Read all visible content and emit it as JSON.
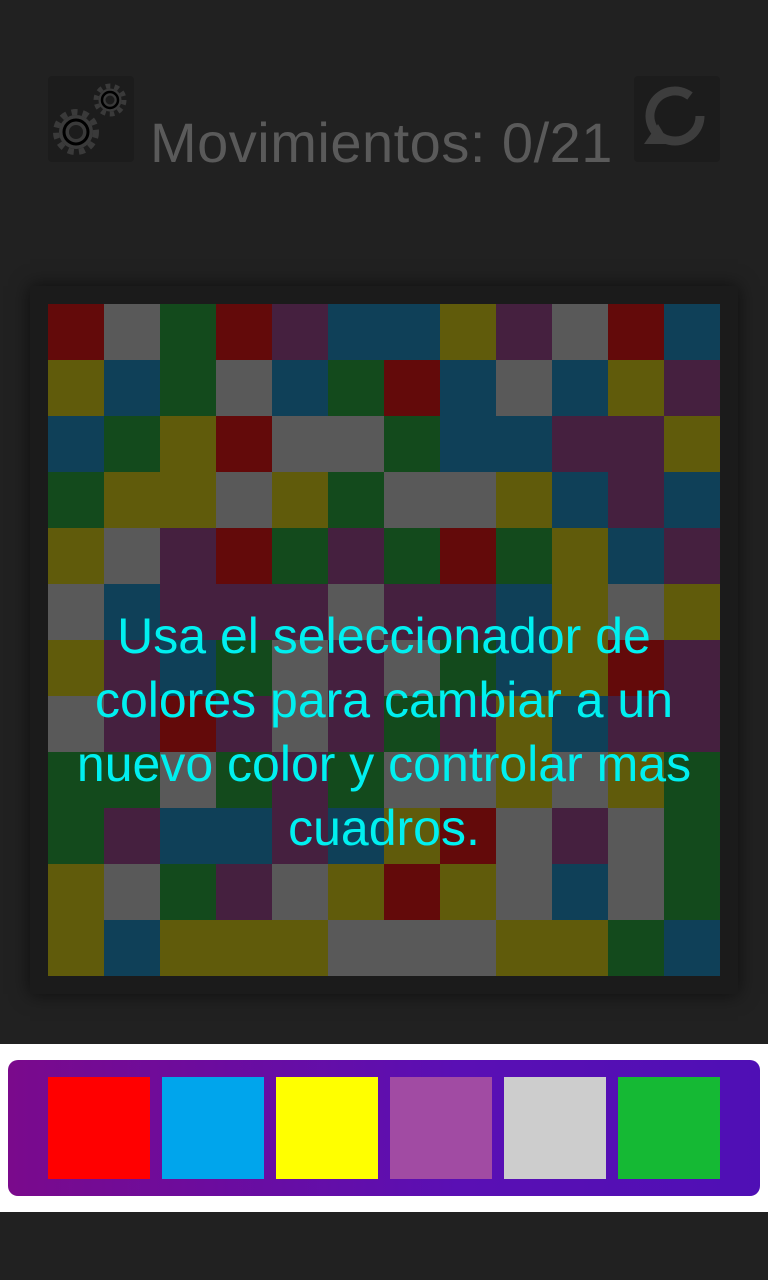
{
  "header": {
    "moves_label": "Movimientos: 0/21",
    "settings_icon": "gears-icon",
    "reset_icon": "refresh-icon"
  },
  "colors": {
    "R": "#630a0a",
    "G": "#595959",
    "N": "#134a1c",
    "B": "#0f4058",
    "P": "#45203f",
    "Y": "#605b0b"
  },
  "board": {
    "size": 12,
    "rows": [
      "RGNRPBBYPGRB",
      "YBNGBNRBGBYP",
      "BNYRGGNBBPPY",
      "NYYGYNGGYBPB",
      "YGPRNPNRNYBP",
      "GBPPPGPPBYGY",
      "YPBNGPGNBYRP",
      "GPRPGPNPYBPP",
      "NNGNPNGGYGYN",
      "NPBBPBYRGPGN",
      "YGNPGYRYGBGN",
      "YBYYYGGGYYNB"
    ]
  },
  "tip": {
    "text": "Usa el seleccionador de colores para cambiar a un nuevo color y controlar mas cuadros."
  },
  "palette": {
    "swatches": [
      {
        "name": "red",
        "color": "#ff0000"
      },
      {
        "name": "blue",
        "color": "#00a5ec"
      },
      {
        "name": "yellow",
        "color": "#ffff00"
      },
      {
        "name": "purple",
        "color": "#a14ba3"
      },
      {
        "name": "gray",
        "color": "#cdcdcd"
      },
      {
        "name": "green",
        "color": "#15b934"
      }
    ]
  }
}
